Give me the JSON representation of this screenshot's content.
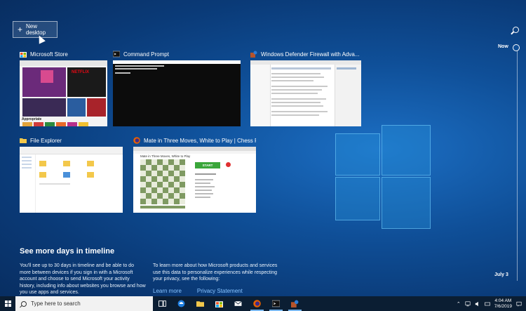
{
  "new_desktop": {
    "label": "New desktop"
  },
  "windows": [
    {
      "title": "Microsoft Store"
    },
    {
      "title": "Command Prompt"
    },
    {
      "title": "Windows Defender Firewall with Adva..."
    },
    {
      "title": "File Explorer"
    },
    {
      "title": "Mate in Three Moves, White to Play | Chess P..."
    }
  ],
  "thumbs": {
    "store_brand": "NETFLIX",
    "store_apps_label": "Appropriate",
    "chess_heading": "Mate in Three Moves, White to Play",
    "chess_start": "START"
  },
  "timeline": {
    "now": "Now",
    "date": "July 3"
  },
  "more_days": {
    "title": "See more days in timeline",
    "text1": "You'll see up to 30 days in timeline and be able to do more between devices if you sign in with a Microsoft account and choose to send Microsoft your activity history, including info about websites you browse and how you use apps and services.",
    "text2": "To learn more about how Microsoft products and services use this data to personalize experiences while respecting your privacy, see the following:",
    "learn_more": "Learn more",
    "privacy": "Privacy Statement"
  },
  "taskbar": {
    "search_placeholder": "Type here to search",
    "time": "4:04 AM",
    "date": "7/6/2019"
  },
  "colors": {
    "accent": "#0f4f98",
    "link": "#88c4ff",
    "taskbar": "#0b1e33"
  }
}
